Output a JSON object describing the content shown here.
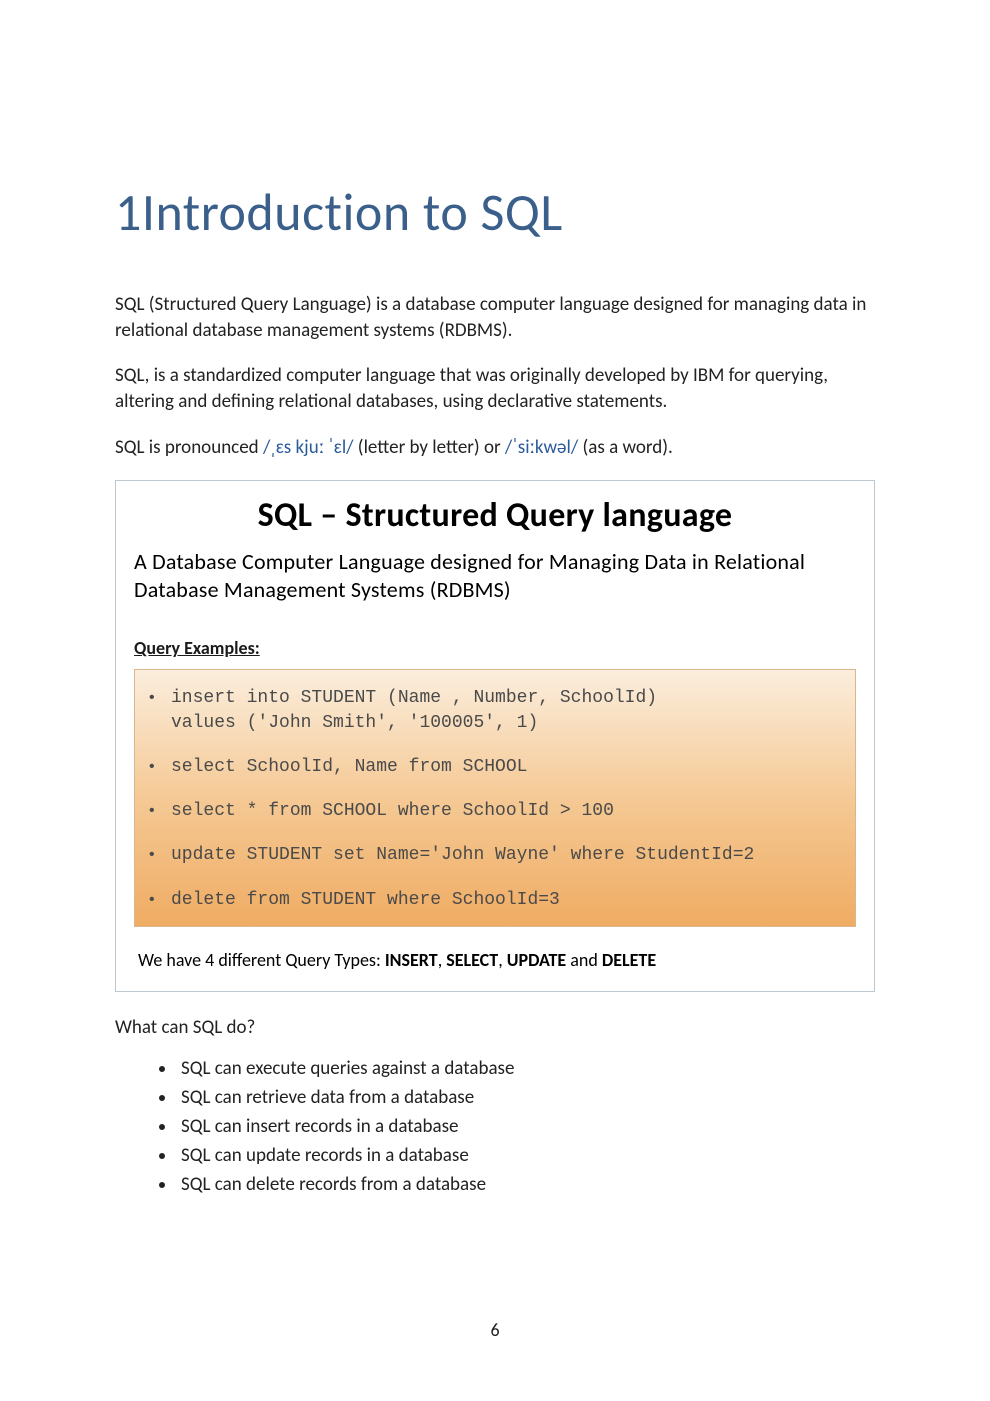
{
  "heading": "1Introduction to SQL",
  "paragraphs": {
    "p1": "SQL (Structured Query Language) is a database computer language designed for managing data in relational database management systems (RDBMS).",
    "p2": "SQL, is a standardized computer language that was originally developed by IBM for querying, altering and defining relational databases, using declarative statements.",
    "p3_pre": "SQL is pronounced ",
    "p3_phon1": "/ˌɛs kjuː ˈɛl/",
    "p3_mid": " (letter by letter) or ",
    "p3_phon2": "/ˈsiːkwəl/",
    "p3_post": " (as a word)."
  },
  "info_box": {
    "title": "SQL – Structured Query language",
    "subtitle": "A Database Computer Language designed for Managing Data in Relational Database Management Systems (RDBMS)",
    "examples_label": "Query Examples:",
    "queries": [
      "insert into STUDENT (Name , Number, SchoolId)\nvalues ('John Smith', '100005', 1)",
      "select SchoolId, Name from SCHOOL",
      "select * from SCHOOL where SchoolId > 100",
      "update STUDENT set Name='John Wayne' where StudentId=2",
      "delete from STUDENT where SchoolId=3"
    ],
    "summary_pre": "We have 4 different  Query Types: ",
    "summary_types": [
      "INSERT",
      "SELECT",
      "UPDATE",
      "DELETE"
    ],
    "summary_and": " and "
  },
  "what_can_q": "What can SQL do?",
  "capabilities": [
    "SQL can execute queries against a database",
    "SQL can retrieve data from a database",
    "SQL can insert records in a database",
    "SQL can update records in a database",
    "SQL can delete records from a database"
  ],
  "page_number": "6"
}
